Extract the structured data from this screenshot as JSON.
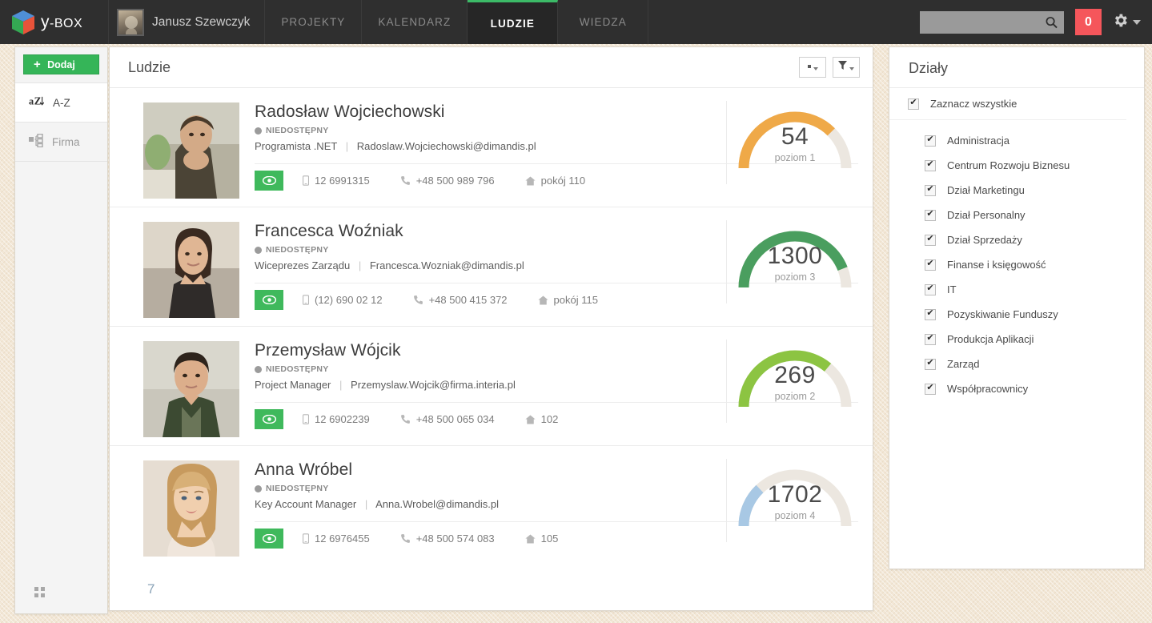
{
  "topbar": {
    "brand_y": "y",
    "brand_box": "-BOX",
    "logo_icon": "cube-logo-icon",
    "user_name": "Janusz Szewczyk",
    "avatar_icon": "user-avatar",
    "nav": [
      {
        "label": "PROJEKTY",
        "active": false
      },
      {
        "label": "KALENDARZ",
        "active": false
      },
      {
        "label": "LUDZIE",
        "active": true
      },
      {
        "label": "WIEDZA",
        "active": false
      }
    ],
    "search_placeholder": "",
    "search_value": "",
    "search_icon": "search-icon",
    "notification_count": "0",
    "settings_icon": "gear-icon",
    "caret_icon": "chevron-down-icon",
    "accent_green": "#3cba67",
    "badge_red": "#f5565b"
  },
  "sidebar": {
    "add_label": "Dodaj",
    "add_plus": "+",
    "items": [
      {
        "label": "A-Z",
        "icon": "sort-alpha-icon",
        "active": true
      },
      {
        "label": "Firma",
        "icon": "org-chart-icon",
        "active": false
      }
    ],
    "bottom_icon": "grid-dots-icon"
  },
  "main": {
    "title": "Ludzie",
    "view_button_icon": "view-options-icon",
    "filter_button_icon": "filter-funnel-icon",
    "page_number": "7",
    "people": [
      {
        "name": "Radosław Wojciechowski",
        "status": "NIEDOSTĘPNY",
        "role": "Programista .NET",
        "email": "Radoslaw.Wojciechowski@dimandis.pl",
        "mobile": "12 6991315",
        "phone": "+48 500 989 796",
        "room": "pokój 110",
        "gauge_value": "54",
        "gauge_level": "poziom 1",
        "gauge_percent": 75,
        "gauge_color": "#efa948",
        "photo_tone_a": "#8e8576",
        "photo_tone_b": "#3f3a33"
      },
      {
        "name": "Francesca Woźniak",
        "status": "NIEDOSTĘPNY",
        "role": "Wiceprezes Zarządu",
        "email": "Francesca.Wozniak@dimandis.pl",
        "mobile": "(12) 690 02 12",
        "phone": "+48 500 415 372",
        "room": "pokój 115",
        "gauge_value": "1300",
        "gauge_level": "poziom 3",
        "gauge_percent": 88,
        "gauge_color": "#4a9e5f",
        "photo_tone_a": "#9d8d80",
        "photo_tone_b": "#2e2a28"
      },
      {
        "name": "Przemysław Wójcik",
        "status": "NIEDOSTĘPNY",
        "role": "Project Manager",
        "email": "Przemyslaw.Wojcik@firma.interia.pl",
        "mobile": "12 6902239",
        "phone": "+48 500 065 034",
        "room": "102",
        "gauge_value": "269",
        "gauge_level": "poziom 2",
        "gauge_percent": 72,
        "gauge_color": "#8cc442",
        "photo_tone_a": "#6f7660",
        "photo_tone_b": "#2c3326"
      },
      {
        "name": "Anna Wróbel",
        "status": "NIEDOSTĘPNY",
        "role": "Key Account Manager",
        "email": "Anna.Wrobel@dimandis.pl",
        "mobile": "12 6976455",
        "phone": "+48 500 574 083",
        "room": "105",
        "gauge_value": "1702",
        "gauge_level": "poziom 4",
        "gauge_percent": 26,
        "gauge_color": "#a8c8e4",
        "photo_tone_a": "#d6bc9b",
        "photo_tone_b": "#8c6f52"
      }
    ]
  },
  "departments": {
    "title": "Działy",
    "select_all_label": "Zaznacz wszystkie",
    "items": [
      {
        "label": "Administracja",
        "checked": true
      },
      {
        "label": "Centrum Rozwoju Biznesu",
        "checked": true
      },
      {
        "label": "Dział Marketingu",
        "checked": true
      },
      {
        "label": "Dział Personalny",
        "checked": true
      },
      {
        "label": "Dział Sprzedaży",
        "checked": true
      },
      {
        "label": "Finanse i księgowość",
        "checked": true
      },
      {
        "label": "IT",
        "checked": true
      },
      {
        "label": "Pozyskiwanie Funduszy",
        "checked": true
      },
      {
        "label": "Produkcja Aplikacji",
        "checked": true
      },
      {
        "label": "Zarząd",
        "checked": true
      },
      {
        "label": "Współpracownicy",
        "checked": true
      }
    ]
  }
}
